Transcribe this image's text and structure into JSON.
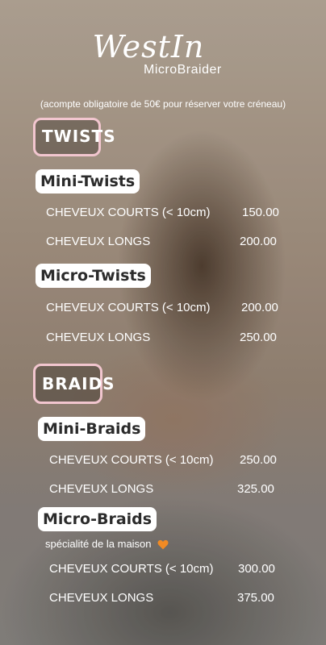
{
  "logo": {
    "name": "WestIn",
    "subtitle": "MicroBraider"
  },
  "note": "(acompte obligatoire de 50€ pour réserver votre créneau)",
  "sections": {
    "twists": {
      "label": "TWISTS"
    },
    "braids": {
      "label": "BRAIDS"
    }
  },
  "mini_twists": {
    "title": "Mini-Twists",
    "short_label": "CHEVEUX COURTS (< 10cm)",
    "short_price": "150.00",
    "long_label": "CHEVEUX LONGS",
    "long_price": "200.00"
  },
  "micro_twists": {
    "title": "Micro-Twists",
    "short_label": "CHEVEUX COURTS (< 10cm)",
    "short_price": "200.00",
    "long_label": "CHEVEUX LONGS",
    "long_price": "250.00"
  },
  "mini_braids": {
    "title": "Mini-Braids",
    "short_label": "CHEVEUX COURTS (< 10cm)",
    "short_price": "250.00",
    "long_label": "CHEVEUX LONGS",
    "long_price": "325.00"
  },
  "micro_braids": {
    "title": "Micro-Braids",
    "specialty": "spécialité de la maison",
    "short_label": "CHEVEUX COURTS (< 10cm)",
    "short_price": "300.00",
    "long_label": "CHEVEUX LONGS",
    "long_price": "375.00"
  },
  "colors": {
    "accent_pink": "#f2c6cf",
    "heart": "#f08a24"
  },
  "icons": {
    "specialty": "orange-heart-icon"
  }
}
